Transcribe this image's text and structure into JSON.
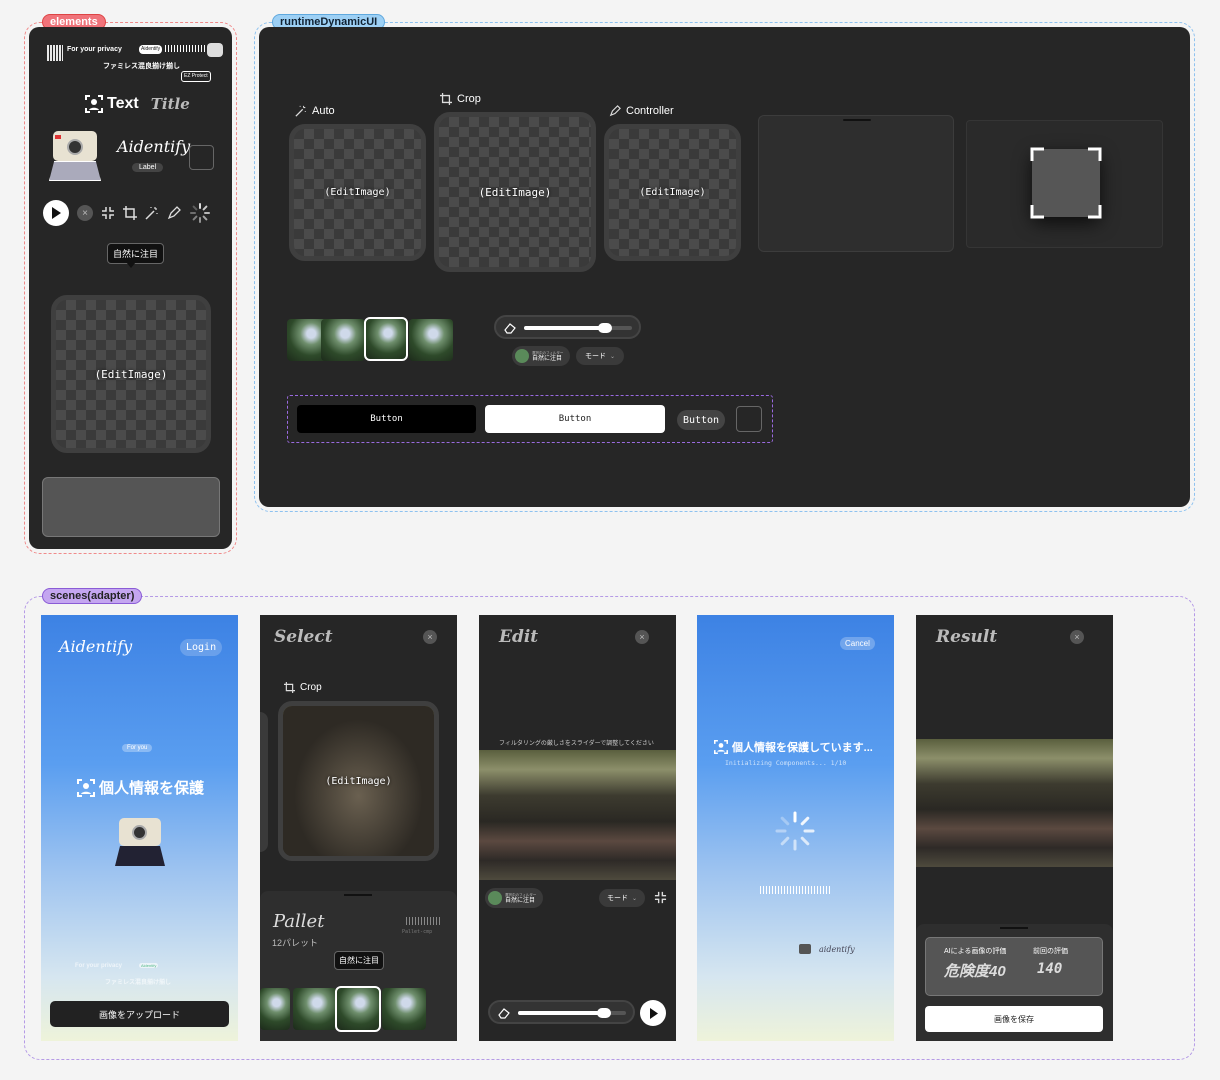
{
  "groups": {
    "elements": "elements",
    "runtime": "runtimeDynamicUI",
    "scenes": "scenes(adapter)"
  },
  "colors": {
    "elements_tag": "#f0737a",
    "runtime_tag": "#5fb4ee",
    "scenes_tag": "#a070e0",
    "panel": "#262626",
    "card_border": "#3f3f3f"
  },
  "elements_panel": {
    "brand_row": {
      "privacy": "For your privacy",
      "badge": "Aidentify",
      "jp_text": "ファミレス混良揃け揃し",
      "protect": "EZ Protect"
    },
    "title_text": "Text",
    "title_script": "Title",
    "app_name": "Aidentify",
    "label_chip": "Label",
    "tooltip": "自然に注目",
    "edit_image": "(EditImage)",
    "icons": [
      "play-icon",
      "close-icon",
      "shrink-icon",
      "crop-icon",
      "magic-wand-icon",
      "pen-icon",
      "spinner-icon"
    ]
  },
  "runtime_panel": {
    "cards": [
      {
        "label": "Auto",
        "icon": "magic-wand-icon",
        "content": "(EditImage)"
      },
      {
        "label": "Crop",
        "icon": "crop-icon",
        "content": "(EditImage)"
      },
      {
        "label": "Controller",
        "icon": "pen-icon",
        "content": "(EditImage)"
      }
    ],
    "filter_chip": "自然に注目",
    "filter_chip_sub": "選択中のフィルター",
    "mode_label": "モード",
    "slider_value": 0.75,
    "buttons": [
      "Button",
      "Button",
      "Button"
    ]
  },
  "scenes": {
    "home": {
      "logo": "Aidentify",
      "login": "Login",
      "for_you": "For you",
      "headline": "個人情報を保護",
      "privacy": "For your privacy",
      "badge": "Aidentify",
      "jp_text": "ファミレス混良揃け揃し",
      "upload": "画像をアップロード"
    },
    "select": {
      "title": "Select",
      "crop": "Crop",
      "edit_image": "(EditImage)",
      "pallet_title": "Pallet",
      "pallet_count": "12パレット",
      "pallet_code": "Pallet-cmp",
      "tooltip": "自然に注目"
    },
    "edit": {
      "title": "Edit",
      "hint": "フィルタリングの厳しさをスライダーで調整してください",
      "filter_chip": "自然に注目",
      "filter_chip_sub": "選択中のフィルター",
      "mode": "モード",
      "slider_value": 0.8
    },
    "loading": {
      "cancel": "Cancel",
      "headline": "個人情報を保護しています...",
      "sub": "Initializing Components... 1/10",
      "brand": "aidentify"
    },
    "result": {
      "title": "Result",
      "ai_label": "AIによる画像の評価",
      "prev_label": "前回の評価",
      "risk": "危険度40",
      "prev_value": "140",
      "save": "画像を保存"
    }
  }
}
